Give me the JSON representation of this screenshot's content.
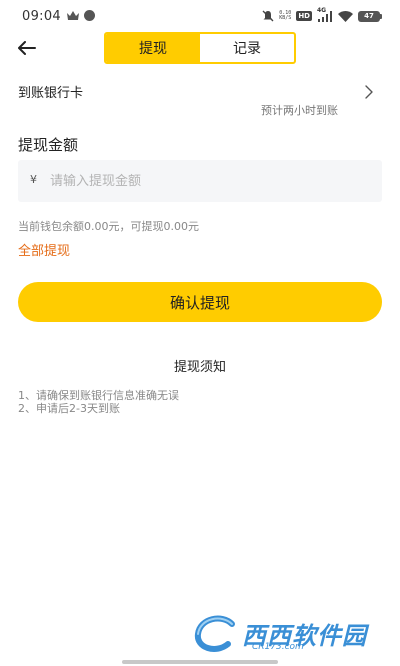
{
  "status_bar": {
    "time": "09:04",
    "net_speed_value": "0.10",
    "net_speed_unit": "KB/S",
    "hd_badge": "HD",
    "signal_label": "4G",
    "battery": "47"
  },
  "header": {
    "tabs": [
      {
        "label": "提现",
        "active": true
      },
      {
        "label": "记录",
        "active": false
      }
    ]
  },
  "bank": {
    "label": "到账银行卡",
    "hint": "预计两小时到账"
  },
  "amount": {
    "title": "提现金额",
    "currency_symbol": "¥",
    "placeholder": "请输入提现金额",
    "balance_text": "当前钱包余额0.00元，可提现0.00元",
    "withdraw_all": "全部提现"
  },
  "confirm_button": "确认提现",
  "notice": {
    "title": "提现须知",
    "items": [
      "1、请确保到账银行信息准确无误",
      "2、申请后2-3天到账"
    ]
  },
  "watermark": {
    "brand": "西西软件园",
    "url": "CR173.com"
  },
  "colors": {
    "accent": "#FFCC00",
    "link_orange": "#e56b16",
    "watermark_blue": "#3a8fd6"
  }
}
